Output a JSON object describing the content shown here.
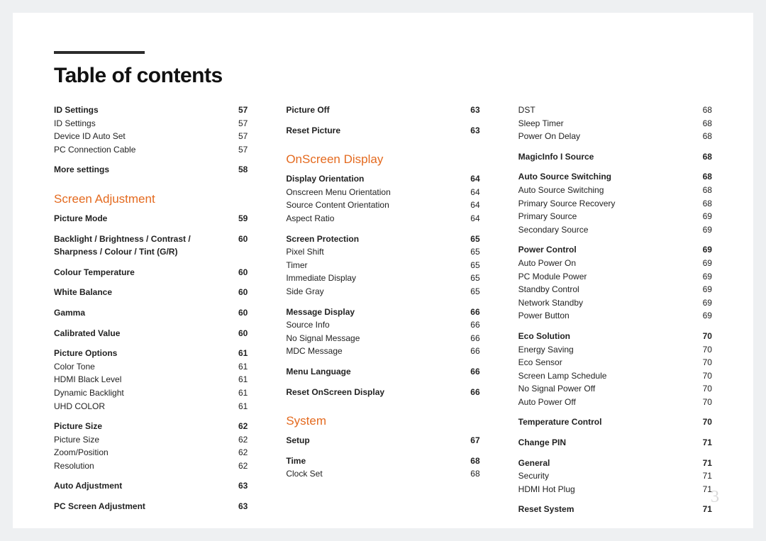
{
  "title": "Table of contents",
  "page_number": "3",
  "columns": [
    [
      {
        "type": "row",
        "bold": true,
        "label": "ID Settings",
        "page": "57"
      },
      {
        "type": "row",
        "label": "ID Settings",
        "page": "57"
      },
      {
        "type": "row",
        "label": "Device ID Auto Set",
        "page": "57"
      },
      {
        "type": "row",
        "label": "PC Connection Cable",
        "page": "57"
      },
      {
        "type": "gap"
      },
      {
        "type": "row",
        "bold": true,
        "label": "More settings",
        "page": "58"
      },
      {
        "type": "section",
        "label": "Screen Adjustment"
      },
      {
        "type": "row",
        "bold": true,
        "label": "Picture Mode",
        "page": "59"
      },
      {
        "type": "gap"
      },
      {
        "type": "row",
        "bold": true,
        "label": "Backlight / Brightness / Contrast / Sharpness / Colour / Tint (G/R)",
        "page": "60"
      },
      {
        "type": "gap"
      },
      {
        "type": "row",
        "bold": true,
        "label": "Colour Temperature",
        "page": "60"
      },
      {
        "type": "gap"
      },
      {
        "type": "row",
        "bold": true,
        "label": "White Balance",
        "page": "60"
      },
      {
        "type": "gap"
      },
      {
        "type": "row",
        "bold": true,
        "label": "Gamma",
        "page": "60"
      },
      {
        "type": "gap"
      },
      {
        "type": "row",
        "bold": true,
        "label": "Calibrated Value",
        "page": "60"
      },
      {
        "type": "gap"
      },
      {
        "type": "row",
        "bold": true,
        "label": "Picture Options",
        "page": "61"
      },
      {
        "type": "row",
        "label": "Color Tone",
        "page": "61"
      },
      {
        "type": "row",
        "label": "HDMI Black Level",
        "page": "61"
      },
      {
        "type": "row",
        "label": "Dynamic Backlight",
        "page": "61"
      },
      {
        "type": "row",
        "label": "UHD COLOR",
        "page": "61"
      },
      {
        "type": "gap"
      },
      {
        "type": "row",
        "bold": true,
        "label": "Picture Size",
        "page": "62"
      },
      {
        "type": "row",
        "label": "Picture Size",
        "page": "62"
      },
      {
        "type": "row",
        "label": "Zoom/Position",
        "page": "62"
      },
      {
        "type": "row",
        "label": "Resolution",
        "page": "62"
      },
      {
        "type": "gap"
      },
      {
        "type": "row",
        "bold": true,
        "label": "Auto Adjustment",
        "page": "63"
      },
      {
        "type": "gap"
      },
      {
        "type": "row",
        "bold": true,
        "label": "PC Screen Adjustment",
        "page": "63"
      }
    ],
    [
      {
        "type": "row",
        "bold": true,
        "label": "Picture Off",
        "page": "63"
      },
      {
        "type": "gap"
      },
      {
        "type": "row",
        "bold": true,
        "label": "Reset Picture",
        "page": "63"
      },
      {
        "type": "section",
        "label": "OnScreen Display"
      },
      {
        "type": "row",
        "bold": true,
        "label": "Display Orientation",
        "page": "64"
      },
      {
        "type": "row",
        "label": "Onscreen Menu Orientation",
        "page": "64"
      },
      {
        "type": "row",
        "label": "Source Content Orientation",
        "page": "64"
      },
      {
        "type": "row",
        "label": "Aspect Ratio",
        "page": "64"
      },
      {
        "type": "gap"
      },
      {
        "type": "row",
        "bold": true,
        "label": "Screen Protection",
        "page": "65"
      },
      {
        "type": "row",
        "label": "Pixel Shift",
        "page": "65"
      },
      {
        "type": "row",
        "label": "Timer",
        "page": "65"
      },
      {
        "type": "row",
        "label": "Immediate Display",
        "page": "65"
      },
      {
        "type": "row",
        "label": "Side Gray",
        "page": "65"
      },
      {
        "type": "gap"
      },
      {
        "type": "row",
        "bold": true,
        "label": "Message Display",
        "page": "66"
      },
      {
        "type": "row",
        "label": "Source Info",
        "page": "66"
      },
      {
        "type": "row",
        "label": "No Signal Message",
        "page": "66"
      },
      {
        "type": "row",
        "label": "MDC Message",
        "page": "66"
      },
      {
        "type": "gap"
      },
      {
        "type": "row",
        "bold": true,
        "label": "Menu Language",
        "page": "66"
      },
      {
        "type": "gap"
      },
      {
        "type": "row",
        "bold": true,
        "label": "Reset OnScreen Display",
        "page": "66"
      },
      {
        "type": "section",
        "label": "System"
      },
      {
        "type": "row",
        "bold": true,
        "label": "Setup",
        "page": "67"
      },
      {
        "type": "gap"
      },
      {
        "type": "row",
        "bold": true,
        "label": "Time",
        "page": "68"
      },
      {
        "type": "row",
        "label": "Clock Set",
        "page": "68"
      }
    ],
    [
      {
        "type": "row",
        "label": "DST",
        "page": "68"
      },
      {
        "type": "row",
        "label": "Sleep Timer",
        "page": "68"
      },
      {
        "type": "row",
        "label": "Power On Delay",
        "page": "68"
      },
      {
        "type": "gap"
      },
      {
        "type": "row",
        "bold": true,
        "label": "MagicInfo I Source",
        "page": "68"
      },
      {
        "type": "gap"
      },
      {
        "type": "row",
        "bold": true,
        "label": "Auto Source Switching",
        "page": "68"
      },
      {
        "type": "row",
        "label": "Auto Source Switching",
        "page": "68"
      },
      {
        "type": "row",
        "label": "Primary Source Recovery",
        "page": "68"
      },
      {
        "type": "row",
        "label": "Primary Source",
        "page": "69"
      },
      {
        "type": "row",
        "label": "Secondary Source",
        "page": "69"
      },
      {
        "type": "gap"
      },
      {
        "type": "row",
        "bold": true,
        "label": "Power Control",
        "page": "69"
      },
      {
        "type": "row",
        "label": "Auto Power On",
        "page": "69"
      },
      {
        "type": "row",
        "label": "PC Module Power",
        "page": "69"
      },
      {
        "type": "row",
        "label": "Standby Control",
        "page": "69"
      },
      {
        "type": "row",
        "label": "Network Standby",
        "page": "69"
      },
      {
        "type": "row",
        "label": "Power Button",
        "page": "69"
      },
      {
        "type": "gap"
      },
      {
        "type": "row",
        "bold": true,
        "label": "Eco Solution",
        "page": "70"
      },
      {
        "type": "row",
        "label": "Energy Saving",
        "page": "70"
      },
      {
        "type": "row",
        "label": "Eco Sensor",
        "page": "70"
      },
      {
        "type": "row",
        "label": "Screen Lamp Schedule",
        "page": "70"
      },
      {
        "type": "row",
        "label": "No Signal Power Off",
        "page": "70"
      },
      {
        "type": "row",
        "label": "Auto Power Off",
        "page": "70"
      },
      {
        "type": "gap"
      },
      {
        "type": "row",
        "bold": true,
        "label": "Temperature Control",
        "page": "70"
      },
      {
        "type": "gap"
      },
      {
        "type": "row",
        "bold": true,
        "label": "Change PIN",
        "page": "71"
      },
      {
        "type": "gap"
      },
      {
        "type": "row",
        "bold": true,
        "label": "General",
        "page": "71"
      },
      {
        "type": "row",
        "label": "Security",
        "page": "71"
      },
      {
        "type": "row",
        "label": "HDMI Hot Plug",
        "page": "71"
      },
      {
        "type": "gap"
      },
      {
        "type": "row",
        "bold": true,
        "label": "Reset System",
        "page": "71"
      }
    ]
  ]
}
